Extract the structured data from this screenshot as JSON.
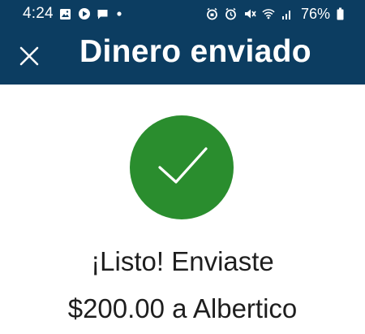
{
  "status_bar": {
    "time": "4:24",
    "battery_percent": "76%",
    "left_icons": [
      "image-icon",
      "play-store-icon",
      "message-icon",
      "dot-icon"
    ],
    "right_icons": [
      "alarm-lock-icon",
      "alarm-clock-icon",
      "mute-icon",
      "wifi-icon",
      "signal-icon",
      "battery-icon"
    ]
  },
  "header": {
    "title": "Dinero enviado",
    "close_icon": "close-icon",
    "background": "#0c3d61"
  },
  "success": {
    "icon": "checkmark-icon",
    "circle_color": "#2a8d2e",
    "line1": "¡Listo! Enviaste",
    "line2": "$200.00 a Albertico"
  }
}
